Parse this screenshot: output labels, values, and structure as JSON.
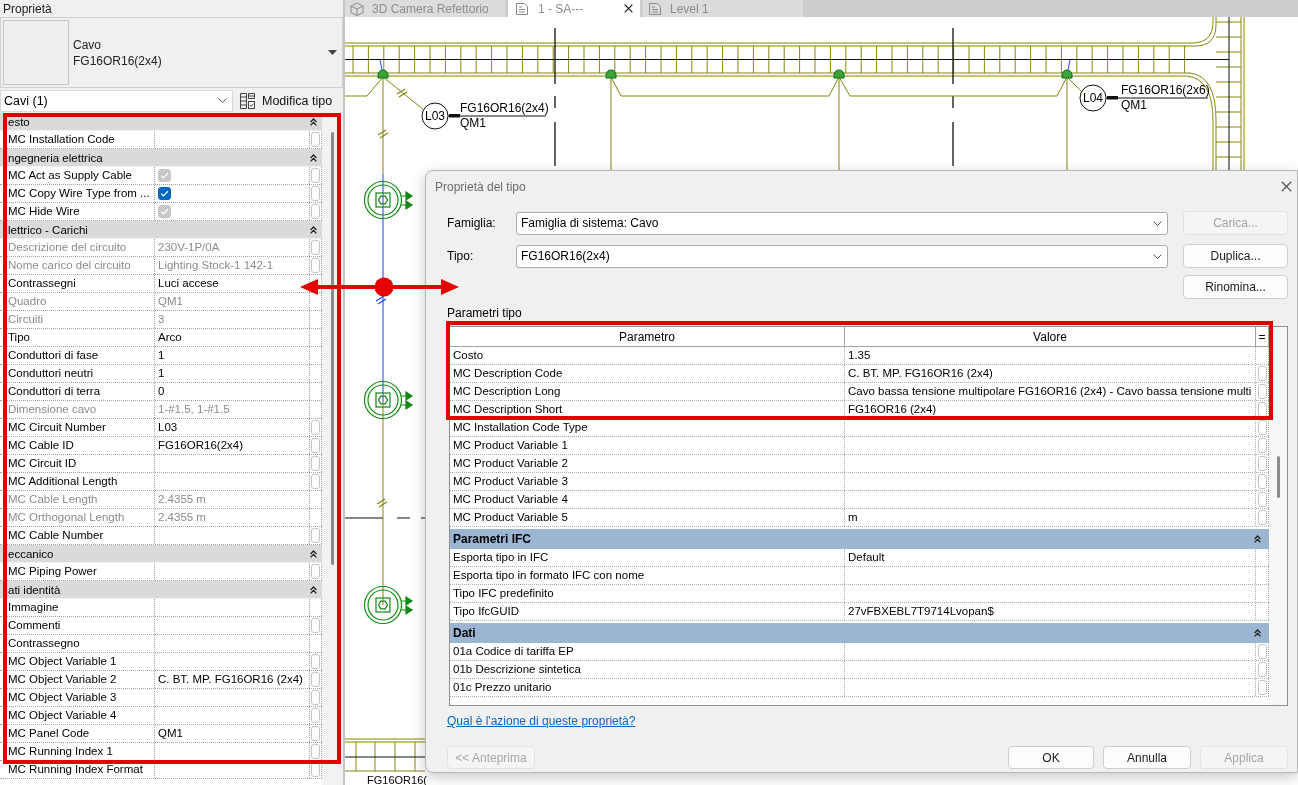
{
  "properties_panel": {
    "title": "Proprietà",
    "type_selector": {
      "category": "Cavo",
      "type": "FG16OR16(2x4)"
    },
    "filter": "Cavi (1)",
    "edit_type_button": "Modifica tipo",
    "rows": [
      {
        "kind": "group",
        "label": "esto",
        "expanded": true
      },
      {
        "kind": "text",
        "name": "MC Installation Code",
        "disabled": false,
        "param_button": true
      },
      {
        "kind": "group",
        "label": "ngegneria elettrica",
        "expanded": true
      },
      {
        "kind": "check",
        "name": "MC Act as Supply Cable",
        "checked": true,
        "disabled": true,
        "param_button": true
      },
      {
        "kind": "check",
        "name": "MC Copy Wire Type from ...",
        "checked": true,
        "disabled": false,
        "param_button": true
      },
      {
        "kind": "check",
        "name": "MC Hide Wire",
        "checked": true,
        "disabled": true,
        "param_button": true
      },
      {
        "kind": "group",
        "label": "lettrico - Carichi",
        "expanded": true
      },
      {
        "kind": "text",
        "name": "Descrizione del circuito",
        "value": "230V-1P/0A",
        "disabled": true,
        "param_button": true
      },
      {
        "kind": "text",
        "name": "Nome carico del circuito",
        "value": "Lighting Stock-1 142-1",
        "disabled": true,
        "param_button": true
      },
      {
        "kind": "text",
        "name": "Contrassegni",
        "value": "Luci accese",
        "disabled": false,
        "param_button": false
      },
      {
        "kind": "text",
        "name": "Quadro",
        "value": "QM1",
        "disabled": true,
        "param_button": false
      },
      {
        "kind": "text",
        "name": "Circuiti",
        "value": "3",
        "disabled": true,
        "param_button": false
      },
      {
        "kind": "text",
        "name": "Tipo",
        "value": "Arco",
        "disabled": false,
        "param_button": false
      },
      {
        "kind": "text",
        "name": "Conduttori di fase",
        "value": "1",
        "disabled": false,
        "param_button": false
      },
      {
        "kind": "text",
        "name": "Conduttori neutri",
        "value": "1",
        "disabled": false,
        "param_button": false
      },
      {
        "kind": "text",
        "name": "Conduttori di terra",
        "value": "0",
        "disabled": false,
        "param_button": false
      },
      {
        "kind": "text",
        "name": "Dimensione cavo",
        "value": "1-#1.5, 1-#1.5",
        "disabled": true,
        "param_button": false
      },
      {
        "kind": "text",
        "name": "MC Circuit Number",
        "value": "L03",
        "disabled": false,
        "param_button": true
      },
      {
        "kind": "text",
        "name": "MC Cable ID",
        "value": "FG16OR16(2x4)",
        "disabled": false,
        "param_button": true
      },
      {
        "kind": "text",
        "name": "MC Circuit ID",
        "disabled": false,
        "param_button": true
      },
      {
        "kind": "text",
        "name": "MC Additional Length",
        "disabled": false,
        "param_button": true
      },
      {
        "kind": "text",
        "name": "MC Cable Length",
        "value": "2.4355 m",
        "disabled": true,
        "param_button": false
      },
      {
        "kind": "text",
        "name": "MC Orthogonal Length",
        "value": "2.4355 m",
        "disabled": true,
        "param_button": false
      },
      {
        "kind": "text",
        "name": "MC Cable Number",
        "disabled": false,
        "param_button": true
      },
      {
        "kind": "group",
        "label": "eccanico",
        "expanded": true
      },
      {
        "kind": "text",
        "name": "MC Piping Power",
        "disabled": false,
        "param_button": true
      },
      {
        "kind": "group",
        "label": "ati identità",
        "expanded": true
      },
      {
        "kind": "text",
        "name": "Immagine",
        "disabled": false,
        "param_button": false
      },
      {
        "kind": "text",
        "name": "Commenti",
        "disabled": false,
        "param_button": true
      },
      {
        "kind": "text",
        "name": "Contrassegno",
        "disabled": false,
        "param_button": false
      },
      {
        "kind": "text",
        "name": "MC Object Variable 1",
        "disabled": false,
        "param_button": true
      },
      {
        "kind": "text",
        "name": "MC Object Variable 2",
        "value": "C. BT. MP. FG16OR16 (2x4)",
        "disabled": false,
        "param_button": true
      },
      {
        "kind": "text",
        "name": "MC Object Variable 3",
        "disabled": false,
        "param_button": true
      },
      {
        "kind": "text",
        "name": "MC Object Variable 4",
        "disabled": false,
        "param_button": true
      },
      {
        "kind": "text",
        "name": "MC Panel Code",
        "value": "QM1",
        "disabled": false,
        "param_button": true
      },
      {
        "kind": "text",
        "name": "MC Running Index 1",
        "disabled": false,
        "param_button": true
      },
      {
        "kind": "text",
        "name": "MC Running Index Format",
        "disabled": false,
        "param_button": true
      }
    ]
  },
  "view_tabs": [
    {
      "label": "3D Camera Refettorio",
      "kind": "perspective",
      "selected": false
    },
    {
      "label": "1 - SA---",
      "kind": "plan",
      "selected": true
    },
    {
      "label": "Level 1",
      "kind": "plan",
      "selected": false
    }
  ],
  "canvas": {
    "tags": [
      {
        "circuit": "L03",
        "cable": "FG16OR16(2x4)",
        "panel": "QM1"
      },
      {
        "circuit": "L04",
        "cable": "FG16OR16(2x6)",
        "panel": "QM1"
      }
    ],
    "bottom_label": "FG16OR16("
  },
  "dialog": {
    "title": "Proprietà del tipo",
    "family": {
      "label": "Famiglia:",
      "value": "Famiglia di sistema: Cavo"
    },
    "type": {
      "label": "Tipo:",
      "value": "FG16OR16(2x4)"
    },
    "side_buttons": [
      {
        "label": "Carica...",
        "disabled": true
      },
      {
        "label": "Duplica...",
        "disabled": false
      },
      {
        "label": "Rinomina...",
        "disabled": false
      }
    ],
    "section_label": "Parametri tipo",
    "table": {
      "columns": [
        "Parametro",
        "Valore",
        "="
      ],
      "rows": [
        {
          "kind": "param",
          "name": "Costo",
          "value": "1.35",
          "param_button": false
        },
        {
          "kind": "param",
          "name": "MC Description Code",
          "value": "C. BT. MP. FG16OR16 (2x4)",
          "param_button": true
        },
        {
          "kind": "param",
          "name": "MC Description Long",
          "value": "Cavo bassa tensione multipolare FG16OR16 (2x4) - Cavo bassa tensione multi",
          "param_button": true
        },
        {
          "kind": "param",
          "name": "MC Description Short",
          "value": "FG16OR16 (2x4)",
          "param_button": true
        },
        {
          "kind": "param",
          "name": "MC Installation Code Type",
          "param_button": true
        },
        {
          "kind": "param",
          "name": "MC Product Variable 1",
          "param_button": true
        },
        {
          "kind": "param",
          "name": "MC Product Variable 2",
          "param_button": true
        },
        {
          "kind": "param",
          "name": "MC Product Variable 3",
          "param_button": true
        },
        {
          "kind": "param",
          "name": "MC Product Variable 4",
          "param_button": true
        },
        {
          "kind": "param",
          "name": "MC Product Variable 5",
          "value": "m",
          "param_button": true
        },
        {
          "kind": "group",
          "label": "Parametri IFC",
          "expanded": true
        },
        {
          "kind": "param",
          "name": "Esporta tipo in IFC",
          "value": "Default",
          "param_button": false
        },
        {
          "kind": "param",
          "name": "Esporta tipo in formato IFC con nome",
          "param_button": false
        },
        {
          "kind": "param",
          "name": "Tipo IFC predefinito",
          "param_button": false
        },
        {
          "kind": "param",
          "name": "Tipo IfcGUID",
          "value": "27vFBXEBL7T9714Lvopan$",
          "param_button": false
        },
        {
          "kind": "group",
          "label": "Dati",
          "expanded": true
        },
        {
          "kind": "param",
          "name": "01a Codice di tariffa EP",
          "param_button": true
        },
        {
          "kind": "param",
          "name": "01b Descrizione sintetica",
          "param_button": true
        },
        {
          "kind": "param",
          "name": "01c Prezzo unitario",
          "param_button": true
        }
      ]
    },
    "help_link": "Qual è l'azione di queste proprietà?",
    "preview_button": {
      "label": "<< Anteprima",
      "disabled": true
    },
    "buttons": [
      {
        "label": "OK",
        "disabled": false
      },
      {
        "label": "Annulla",
        "disabled": false
      },
      {
        "label": "Applica",
        "disabled": true
      }
    ]
  }
}
